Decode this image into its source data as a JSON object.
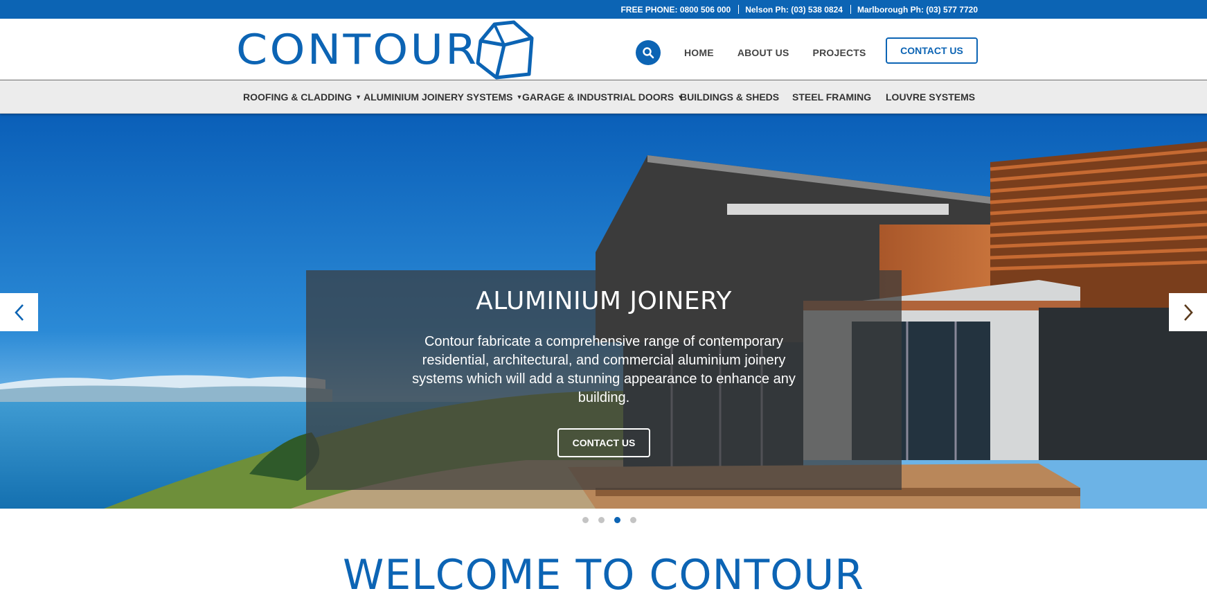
{
  "topbar": {
    "free_phone": "FREE PHONE: 0800 506 000",
    "nelson_phone": "Nelson Ph: (03) 538 0824",
    "marlborough_phone": "Marlborough Ph: (03) 577 7720"
  },
  "header": {
    "logo_text": "CONTOUR",
    "nav": [
      "HOME",
      "ABOUT US",
      "PROJECTS"
    ],
    "contact_label": "CONTACT US"
  },
  "subnav": [
    {
      "label": "ROOFING & CLADDING",
      "dropdown": true
    },
    {
      "label": "ALUMINIUM JOINERY SYSTEMS",
      "dropdown": true
    },
    {
      "label": "GARAGE & INDUSTRIAL DOORS",
      "dropdown": true
    },
    {
      "label": "BUILDINGS & SHEDS",
      "dropdown": false
    },
    {
      "label": "STEEL FRAMING",
      "dropdown": false
    },
    {
      "label": "LOUVRE SYSTEMS",
      "dropdown": false
    }
  ],
  "hero": {
    "title": "ALUMINIUM JOINERY",
    "text": "Contour fabricate a comprehensive range of contemporary residential, architectural, and commercial aluminium joinery systems which will add a stunning appearance to enhance any building.",
    "button_label": "CONTACT US",
    "slide_count": 4,
    "active_slide": 3
  },
  "welcome_heading": "WELCOME TO CONTOUR",
  "colors": {
    "brand_blue": "#0c64b4",
    "topbar": "#0c64b4",
    "subnav_bg": "#ececec",
    "caption_overlay": "rgba(60,60,60,0.72)"
  },
  "icons": {
    "search": "search-icon",
    "logo_mark": "cube-outline-icon",
    "prev": "chevron-left-icon",
    "next": "chevron-right-icon",
    "dropdown": "caret-down-icon"
  }
}
